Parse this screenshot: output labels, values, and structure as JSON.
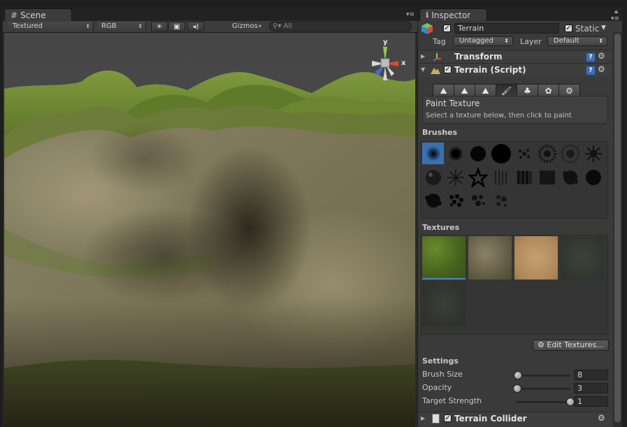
{
  "scene": {
    "tab_label": "Scene",
    "toolbar": {
      "draw_mode": "Textured",
      "render_mode": "RGB",
      "gizmos_label": "Gizmos",
      "search_placeholder": "All"
    },
    "axis_labels": {
      "y": "y",
      "x": "x"
    }
  },
  "inspector": {
    "tab_label": "Inspector",
    "object_name": "Terrain",
    "static_label": "Static",
    "tag_label": "Tag",
    "tag_value": "Untagged",
    "layer_label": "Layer",
    "layer_value": "Default",
    "components": {
      "transform": "Transform",
      "terrain_script": "Terrain (Script)",
      "terrain_collider": "Terrain Collider"
    },
    "paint": {
      "title": "Paint Texture",
      "hint": "Select a texture below, then click to paint"
    },
    "brushes_title": "Brushes",
    "textures_title": "Textures",
    "edit_textures_label": "Edit Textures...",
    "settings_title": "Settings",
    "settings": [
      {
        "label": "Brush Size",
        "value": "8",
        "fraction": 0.04
      },
      {
        "label": "Opacity",
        "value": "3",
        "fraction": 0.02
      },
      {
        "label": "Target Strength",
        "value": "1",
        "fraction": 1.0
      }
    ]
  }
}
